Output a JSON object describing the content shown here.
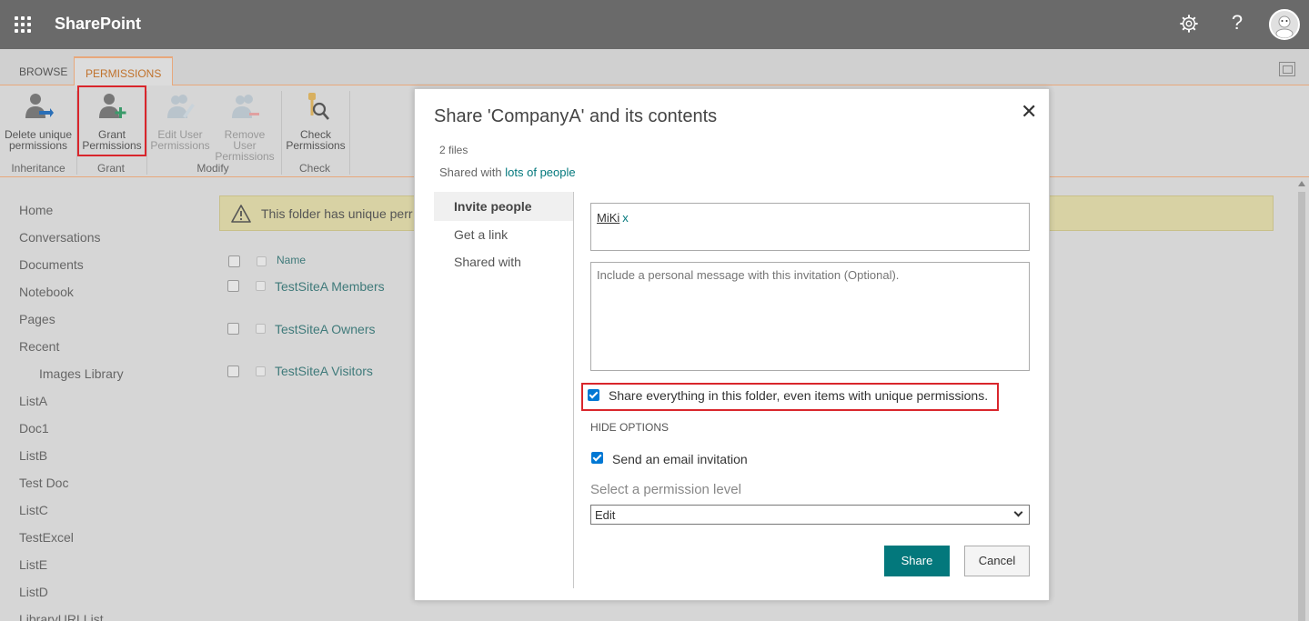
{
  "app": {
    "title": "SharePoint"
  },
  "ribbon": {
    "tabs": [
      {
        "label": "BROWSE"
      },
      {
        "label": "PERMISSIONS"
      }
    ],
    "buttons": {
      "delete_unique": [
        "Delete unique",
        "permissions"
      ],
      "grant": [
        "Grant",
        "Permissions"
      ],
      "edit_user": [
        "Edit User",
        "Permissions"
      ],
      "remove_user": [
        "Remove User",
        "Permissions"
      ],
      "check": [
        "Check",
        "Permissions"
      ]
    },
    "groups": {
      "inheritance": "Inheritance",
      "grant": "Grant",
      "modify": "Modify",
      "check": "Check"
    }
  },
  "leftnav": {
    "items": [
      "Home",
      "Conversations",
      "Documents",
      "Notebook",
      "Pages",
      "Recent",
      "Images Library",
      "ListA",
      "Doc1",
      "ListB",
      "Test Doc",
      "ListC",
      "TestExcel",
      "ListE",
      "ListD",
      "LibraryURLList"
    ]
  },
  "notice": {
    "text": "This folder has unique perr"
  },
  "list": {
    "header": "Name",
    "rows": [
      "TestSiteA Members",
      "TestSiteA Owners",
      "TestSiteA Visitors"
    ]
  },
  "dialog": {
    "title": "Share 'CompanyA' and its contents",
    "files": "2 files",
    "shared_with_prefix": "Shared with",
    "shared_with_link": "lots of people",
    "nav": [
      "Invite people",
      "Get a link",
      "Shared with"
    ],
    "person": "MiKi",
    "person_remove": "x",
    "message_placeholder": "Include a personal message with this invitation (Optional).",
    "share_all_label": "Share everything in this folder, even items with unique permissions.",
    "hide_options": "HIDE OPTIONS",
    "email_label": "Send an email invitation",
    "permission_label": "Select a permission level",
    "permission_value": "Edit",
    "share_button": "Share",
    "cancel_button": "Cancel"
  }
}
